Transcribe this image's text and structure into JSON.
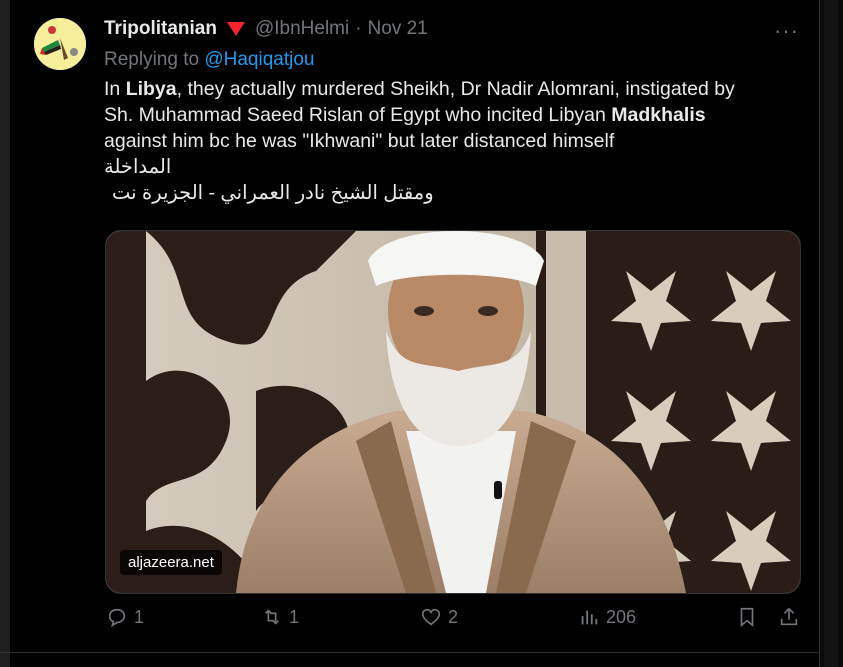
{
  "post": {
    "display_name": "Tripolitanian",
    "handle": "@IbnHelmi",
    "date": "Nov 21",
    "separator": "·",
    "more_label": "···",
    "replying_prefix": "Replying to",
    "replying_handle": "@Haqiqatjou",
    "text": {
      "l1_a": "In ",
      "l1_b": "Libya",
      "l1_c": ", they actually murdered Sheikh, Dr Nadir Alomrani, instigated by",
      "l2_a": "Sh. Muhammad Saeed Rislan of Egypt who incited Libyan ",
      "l2_b": "Madkhalis",
      "l3": "against him bc he was \"Ikhwani\" but later distanced himself",
      "l4": "المداخلة",
      "l5": "ومقتل الشيخ نادر العمراني - الجزيرة نت"
    },
    "media": {
      "watermark": "aljazeera.net",
      "description_icon": "portrait-image"
    },
    "stats": {
      "replies": "1",
      "reposts": "1",
      "likes": "2",
      "views": "206"
    },
    "colors": {
      "accent": "#1d9bf0",
      "muted": "#71767b",
      "badge": "#f4212e"
    }
  }
}
